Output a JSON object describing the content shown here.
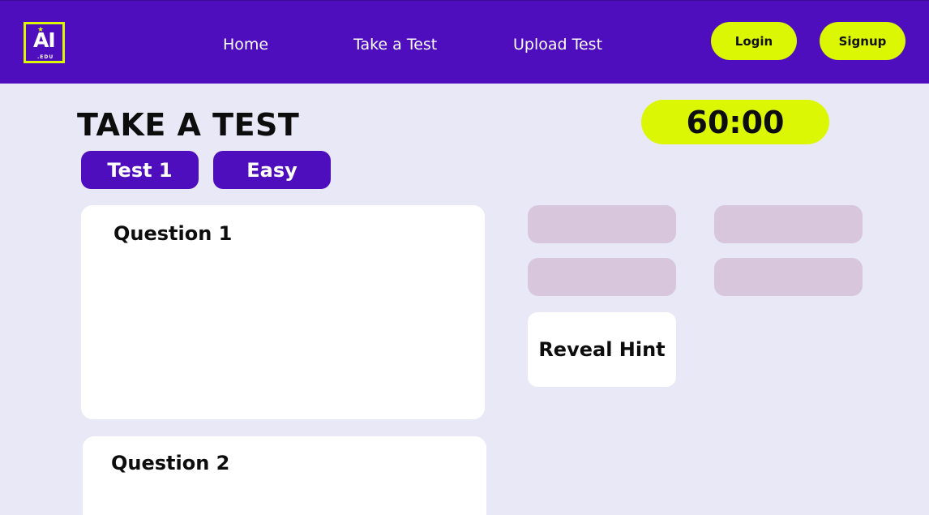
{
  "brand": {
    "logo_main": "AI",
    "logo_sub": ".EDU",
    "logo_star": "★",
    "colors": {
      "primary": "#4f0ebd",
      "accent": "#dbf704",
      "background": "#e8e8f6",
      "option_placeholder": "#d8c6dd"
    }
  },
  "nav": {
    "links": [
      {
        "label": "Home"
      },
      {
        "label": "Take a Test"
      },
      {
        "label": "Upload Test"
      }
    ],
    "login_label": "Login",
    "signup_label": "Signup"
  },
  "page": {
    "title": "TAKE A TEST",
    "timer": "60:00",
    "tags": [
      {
        "label": "Test 1"
      },
      {
        "label": "Easy"
      }
    ]
  },
  "questions": [
    {
      "title": "Question 1"
    },
    {
      "title": "Question 2"
    }
  ],
  "answer_options": [
    {
      "label": ""
    },
    {
      "label": ""
    },
    {
      "label": ""
    },
    {
      "label": ""
    }
  ],
  "hint": {
    "label": "Reveal Hint"
  }
}
